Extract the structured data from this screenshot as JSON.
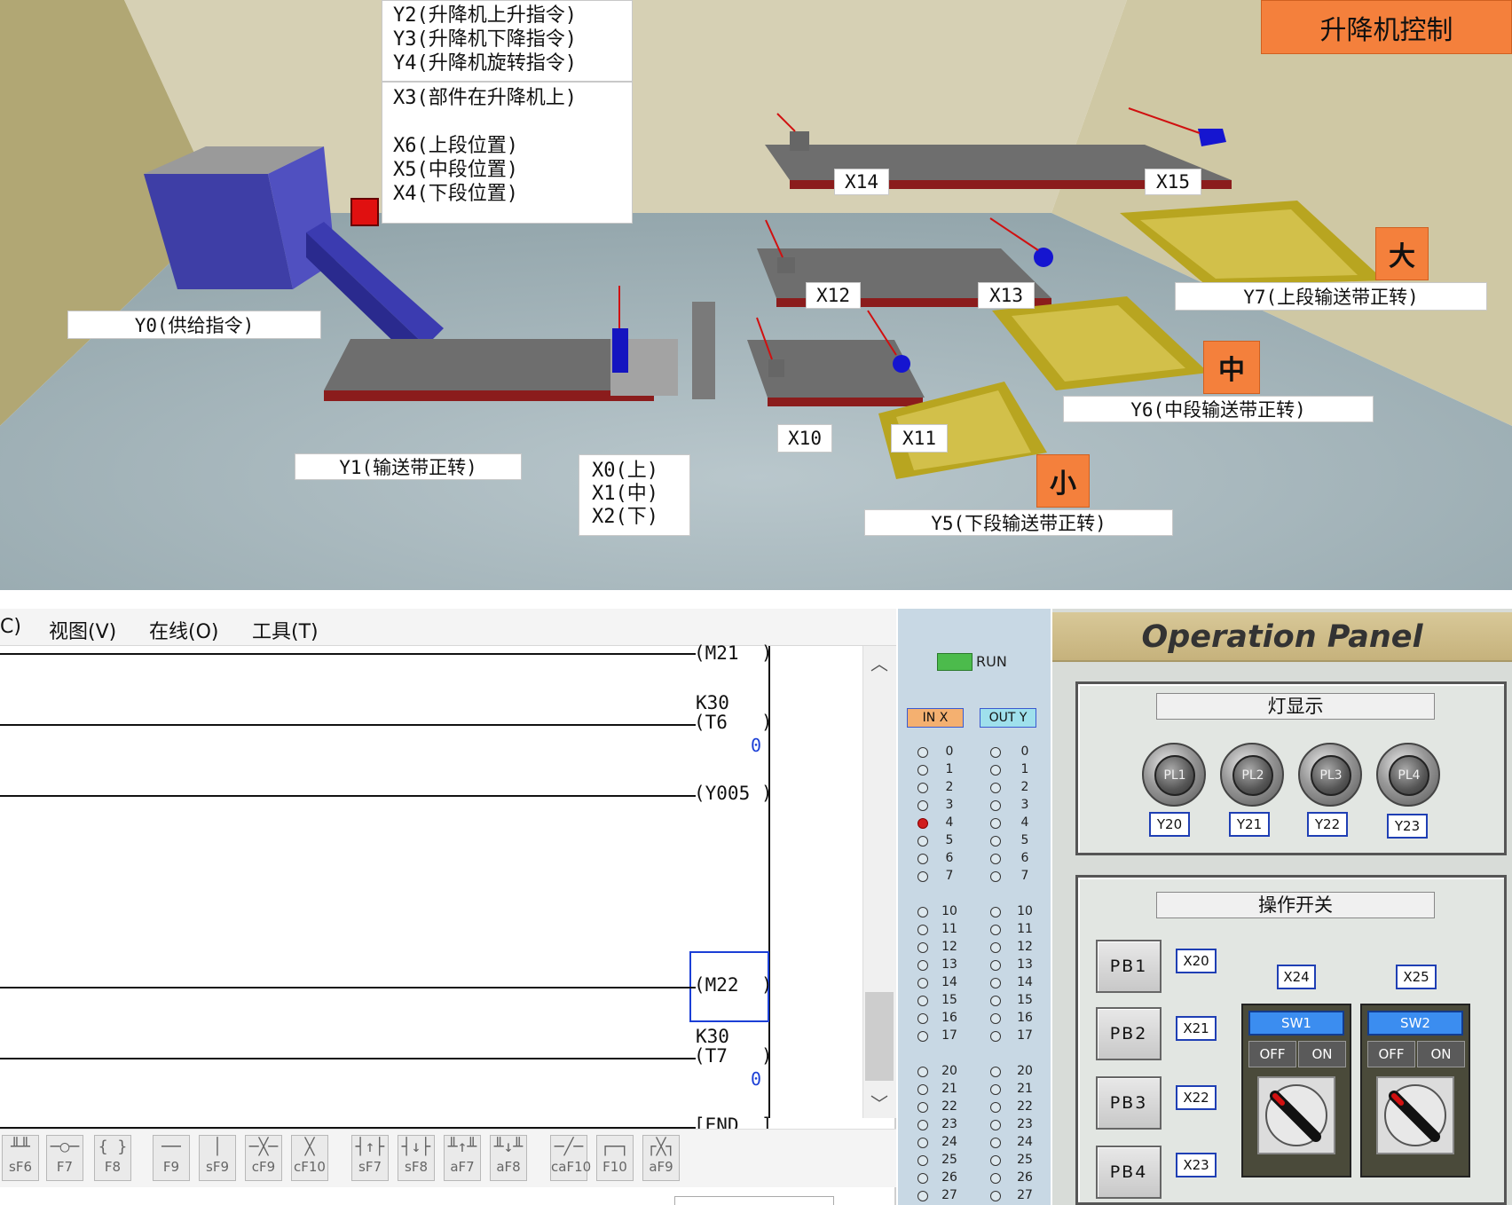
{
  "simulation": {
    "title": "升降机控制",
    "labels": {
      "elevator_outputs": "Y2(升降机上升指令)\nY3(升降机下降指令)\nY4(升降机旋转指令)",
      "elevator_inputs": "X3(部件在升降机上)\n\nX6(上段位置)\nX5(中段位置)\nX4(下段位置)",
      "y0": "Y0(供给指令)",
      "y1": "Y1(输送带正转)",
      "x_lift": "X0(上)\nX1(中)\nX2(下)",
      "x10": "X10",
      "x11": "X11",
      "x12": "X12",
      "x13": "X13",
      "x14": "X14",
      "x15": "X15",
      "y5": "Y5(下段输送带正转)",
      "y6": "Y6(中段输送带正转)",
      "y7": "Y7(上段输送带正转)",
      "size_large": "大",
      "size_medium": "中",
      "size_small": "小"
    }
  },
  "ladder": {
    "menu": [
      "C)",
      "视图(V)",
      "在线(O)",
      "工具(T)"
    ],
    "rungs": [
      {
        "coil": "(M21  )"
      },
      {
        "const": "K30",
        "coil": "(T6   )",
        "current": "0"
      },
      {
        "coil": "(Y005 )"
      },
      {
        "coil": "(M22  )"
      },
      {
        "const": "K30",
        "coil": "(T7   )",
        "current": "0"
      },
      {
        "coil": "[END  ]"
      }
    ],
    "toolbar": [
      {
        "sym": "╨╨",
        "key": "sF6"
      },
      {
        "sym": "─○─",
        "key": "F7"
      },
      {
        "sym": "{ }",
        "key": "F8"
      },
      {
        "sym": "──",
        "key": "F9"
      },
      {
        "sym": "│",
        "key": "sF9"
      },
      {
        "sym": "─╳─",
        "key": "cF9"
      },
      {
        "sym": "╳",
        "key": "cF10"
      },
      {
        "sym": "┤↑├",
        "key": "sF7"
      },
      {
        "sym": "┤↓├",
        "key": "sF8"
      },
      {
        "sym": "╨↑╨",
        "key": "aF7"
      },
      {
        "sym": "╨↓╨",
        "key": "aF8"
      },
      {
        "sym": "─╱─",
        "key": "caF10"
      },
      {
        "sym": "┌─┐",
        "key": "F10"
      },
      {
        "sym": "┌╳┐",
        "key": "aF9"
      }
    ],
    "status": "RUN"
  },
  "io_monitor": {
    "run_label": "RUN",
    "in_header": "IN X",
    "out_header": "OUT Y",
    "numbers": [
      "0",
      "1",
      "2",
      "3",
      "4",
      "5",
      "6",
      "7",
      "10",
      "11",
      "12",
      "13",
      "14",
      "15",
      "16",
      "17",
      "20",
      "21",
      "22",
      "23",
      "24",
      "25",
      "26",
      "27"
    ],
    "active_inputs": [
      "4"
    ]
  },
  "operation_panel": {
    "title": "Operation Panel",
    "lamp_group_title": "灯显示",
    "lamps": [
      {
        "name": "PL1",
        "addr": "Y20"
      },
      {
        "name": "PL2",
        "addr": "Y21"
      },
      {
        "name": "PL3",
        "addr": "Y22"
      },
      {
        "name": "PL4",
        "addr": "Y23"
      }
    ],
    "switch_group_title": "操作开关",
    "buttons": [
      {
        "name": "PB1",
        "addr": "X20"
      },
      {
        "name": "PB2",
        "addr": "X21"
      },
      {
        "name": "PB3",
        "addr": "X22"
      },
      {
        "name": "PB4",
        "addr": "X23"
      }
    ],
    "switches": [
      {
        "name": "SW1",
        "addr": "X24",
        "off": "OFF",
        "on": "ON"
      },
      {
        "name": "SW2",
        "addr": "X25",
        "off": "OFF",
        "on": "ON"
      }
    ]
  }
}
